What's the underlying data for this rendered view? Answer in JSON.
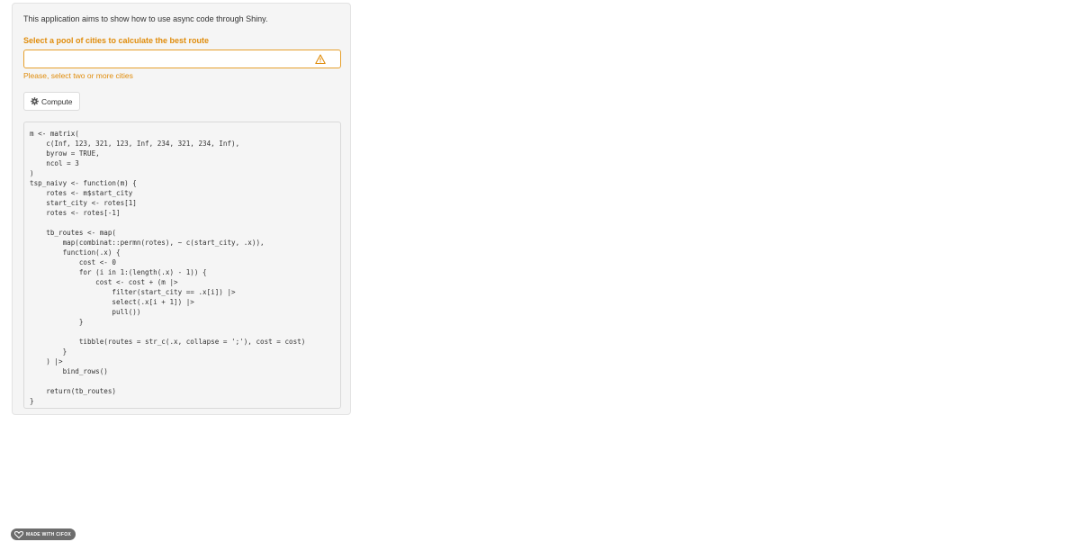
{
  "intro_text": "This application aims to show how to use async code through Shiny.",
  "city_select": {
    "label": "Select a pool of cities to calculate the best route",
    "value": "",
    "validation_message": "Please, select two or more cities",
    "icon": "warning-triangle-icon",
    "warning_color": "#e08c0b"
  },
  "compute_button": {
    "label": "Compute",
    "icon": "gear-icon"
  },
  "code_lines": [
    "m <- matrix(",
    "    c(Inf, 123, 321, 123, Inf, 234, 321, 234, Inf),",
    "    byrow = TRUE,",
    "    ncol = 3",
    ")",
    "tsp_naivy <- function(m) {",
    "    rotes <- m$start_city",
    "    start_city <- rotes[1]",
    "    rotes <- rotes[-1]",
    "",
    "    tb_routes <- map(",
    "        map(combinat::permn(rotes), ~ c(start_city, .x)),",
    "        function(.x) {",
    "            cost <- 0",
    "            for (i in 1:(length(.x) - 1)) {",
    "                cost <- cost + (m |>",
    "                    filter(start_city == .x[i]) |>",
    "                    select(.x[i + 1]) |>",
    "                    pull())",
    "            }",
    "",
    "            tibble(routes = str_c(.x, collapse = ';'), cost = cost)",
    "        }",
    "    ) |>",
    "        bind_rows()",
    "",
    "    return(tb_routes)",
    "}"
  ],
  "badge": {
    "label": "MADE WITH CIFOX",
    "icon": "heart-logo-icon"
  }
}
